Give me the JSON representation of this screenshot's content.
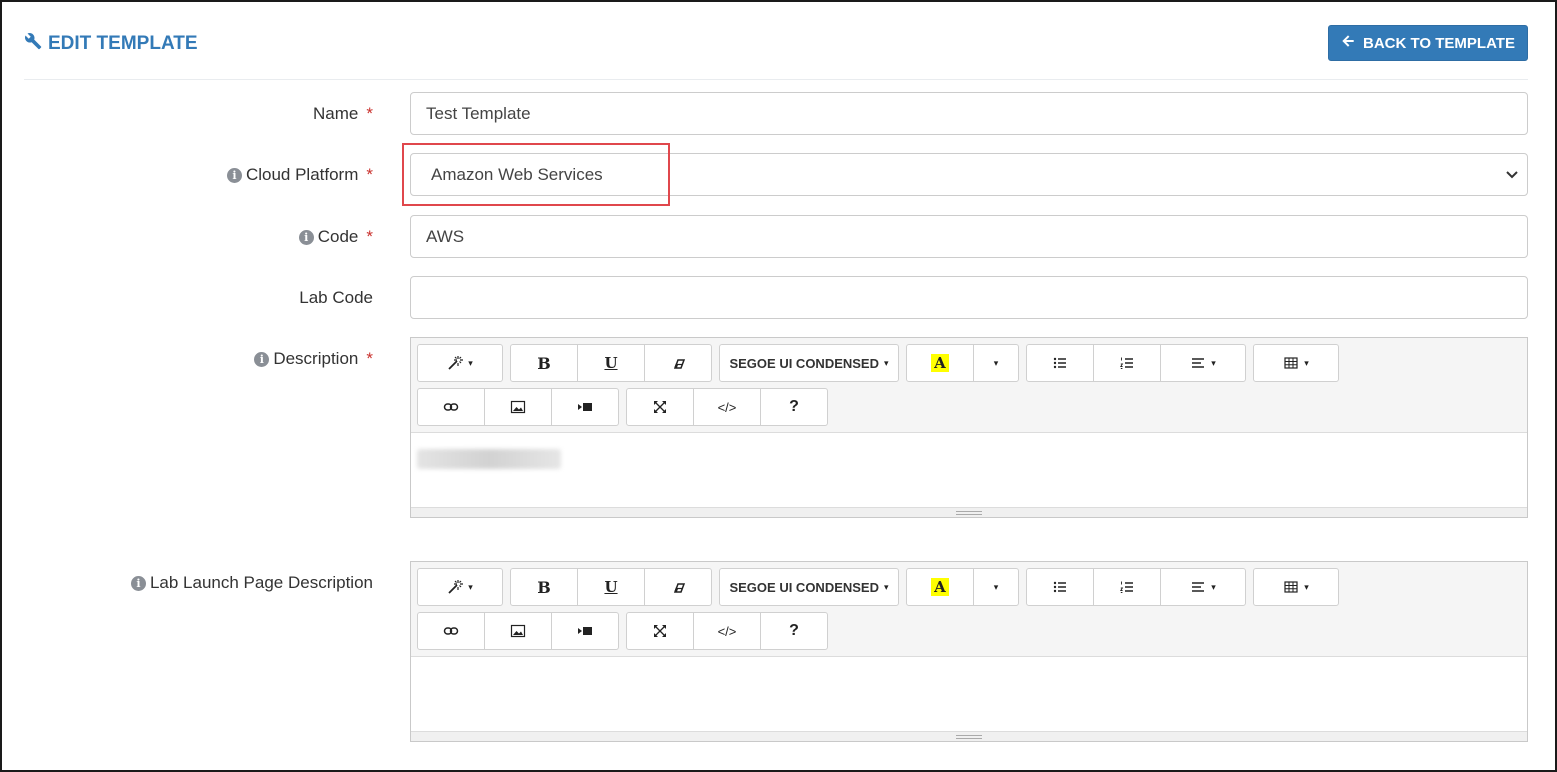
{
  "header": {
    "title": "EDIT TEMPLATE",
    "title_icon": "wrench-icon",
    "back_button": "BACK TO TEMPLATE",
    "accent": "#337ab7"
  },
  "form": {
    "name": {
      "label": "Name",
      "required_mark": "*",
      "value": "Test Template"
    },
    "cloud_platform": {
      "label": "Cloud Platform",
      "required_mark": "*",
      "value": "Amazon Web Services"
    },
    "code": {
      "label": "Code",
      "required_mark": "*",
      "value": "AWS"
    },
    "lab_code": {
      "label": "Lab Code",
      "value": ""
    },
    "description": {
      "label": "Description",
      "required_mark": "*"
    },
    "lab_launch_description": {
      "label": "Lab Launch Page Description"
    }
  },
  "info_glyph": "i",
  "toolbar": {
    "bold": "B",
    "underline": "U",
    "font_name": "SEGOE UI CONDENSED",
    "color_letter": "A",
    "code_view": "</>",
    "help": "?",
    "caret": "▾"
  },
  "highlight_color": "#e0474c"
}
